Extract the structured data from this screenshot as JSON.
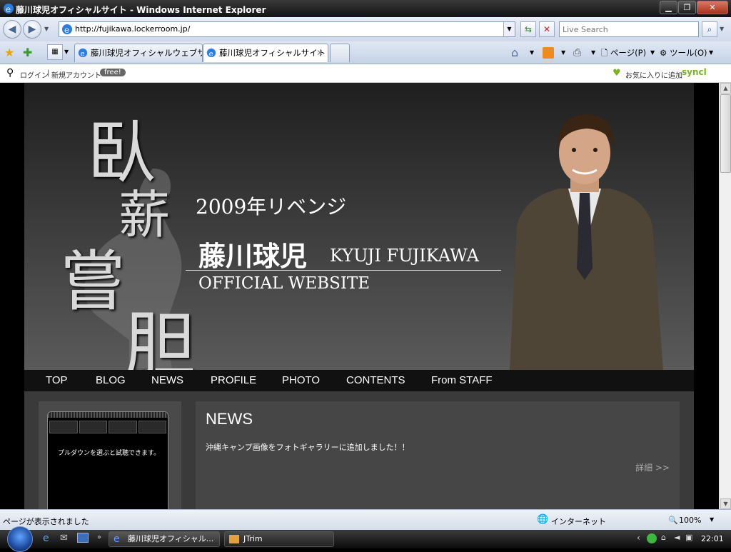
{
  "window": {
    "title": "藤川球児オフィシャルサイト - Windows Internet Explorer"
  },
  "address": {
    "url": "http://fujikawa.lockerroom.jp/"
  },
  "search": {
    "placeholder": "Live Search"
  },
  "tabs": [
    {
      "label": "藤川球児オフィシャルウェブサイト"
    },
    {
      "label": "藤川球児オフィシャルサイト"
    }
  ],
  "commands": {
    "page": "ページ(P)",
    "tools": "ツール(O)"
  },
  "syncl": {
    "login": "ログイン",
    "separator": "|",
    "register": "新規アカウント",
    "free": "free!",
    "favorite": "お気に入りに追加",
    "brand": "syncl"
  },
  "site": {
    "kanji": [
      "臥",
      "薪",
      "嘗",
      "胆"
    ],
    "tagline": "2009年リベンジ",
    "name_ja": "藤川球児",
    "name_en": "KYUJI FUJIKAWA",
    "official": "OFFICIAL WEBSITE",
    "nav": [
      "TOP",
      "BLOG",
      "NEWS",
      "PROFILE",
      "PHOTO",
      "CONTENTS",
      "From STAFF"
    ],
    "widget_text": "プルダウンを選ぶと試聴できます。",
    "news": {
      "title": "NEWS",
      "item": "沖縄キャンプ画像をフォトギャラリーに追加しました！！",
      "more": "詳細 >>"
    }
  },
  "status": {
    "left": "ページが表示されました",
    "zone": "インターネット",
    "zoom": "100%"
  },
  "taskbar": {
    "items": [
      "藤川球児オフィシャル...",
      "JTrim"
    ],
    "clock": "22:01"
  }
}
